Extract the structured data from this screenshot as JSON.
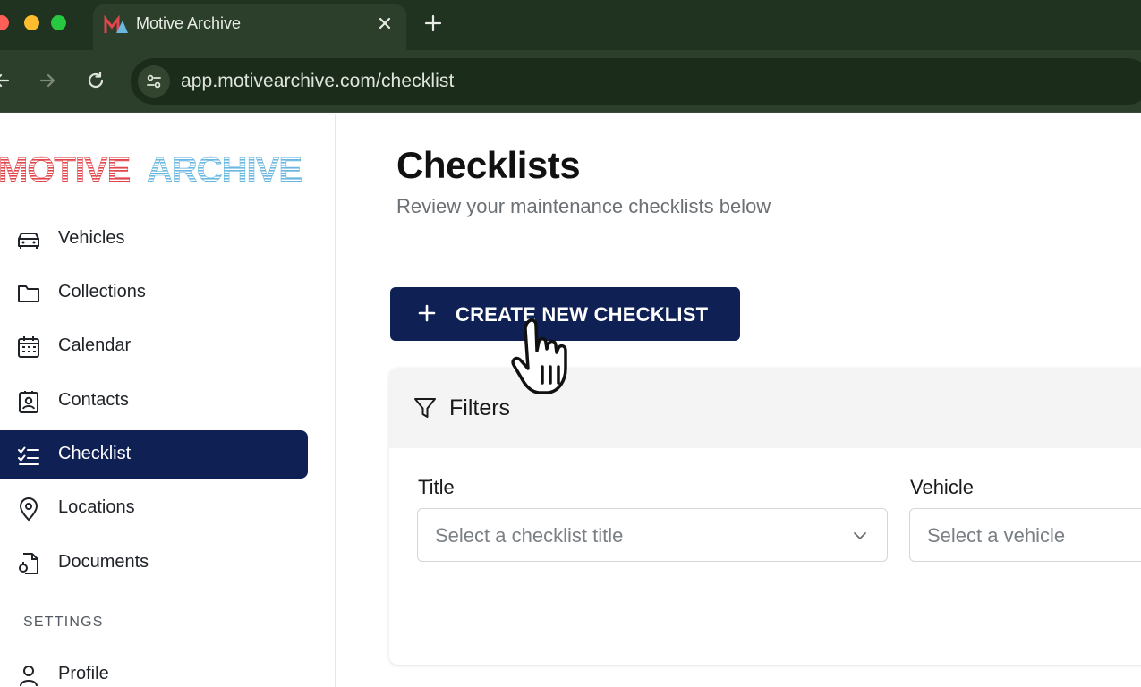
{
  "browser": {
    "tab_title": "Motive Archive",
    "url": "app.motivearchive.com/checklist"
  },
  "sidebar": {
    "logo_text": "MOTIVE ARCHIVE",
    "items": [
      {
        "label": "Vehicles",
        "icon": "car-icon"
      },
      {
        "label": "Collections",
        "icon": "folder-icon"
      },
      {
        "label": "Calendar",
        "icon": "calendar-icon"
      },
      {
        "label": "Contacts",
        "icon": "contact-card-icon"
      },
      {
        "label": "Checklist",
        "icon": "checklist-icon",
        "active": true
      },
      {
        "label": "Locations",
        "icon": "map-pin-icon"
      },
      {
        "label": "Documents",
        "icon": "document-icon"
      }
    ],
    "settings_label": "SETTINGS",
    "settings_items": [
      {
        "label": "Profile",
        "icon": "user-icon"
      }
    ]
  },
  "main": {
    "title": "Checklists",
    "subtitle": "Review your maintenance checklists below",
    "create_button": "CREATE NEW CHECKLIST",
    "filters": {
      "heading": "Filters",
      "title_label": "Title",
      "title_placeholder": "Select a checklist title",
      "vehicle_label": "Vehicle",
      "vehicle_placeholder": "Select a vehicle"
    }
  },
  "colors": {
    "accent_navy": "#0f2054",
    "logo_red": "#e0464b",
    "logo_blue": "#6ab8e0",
    "chrome_dark": "#1f3320"
  }
}
